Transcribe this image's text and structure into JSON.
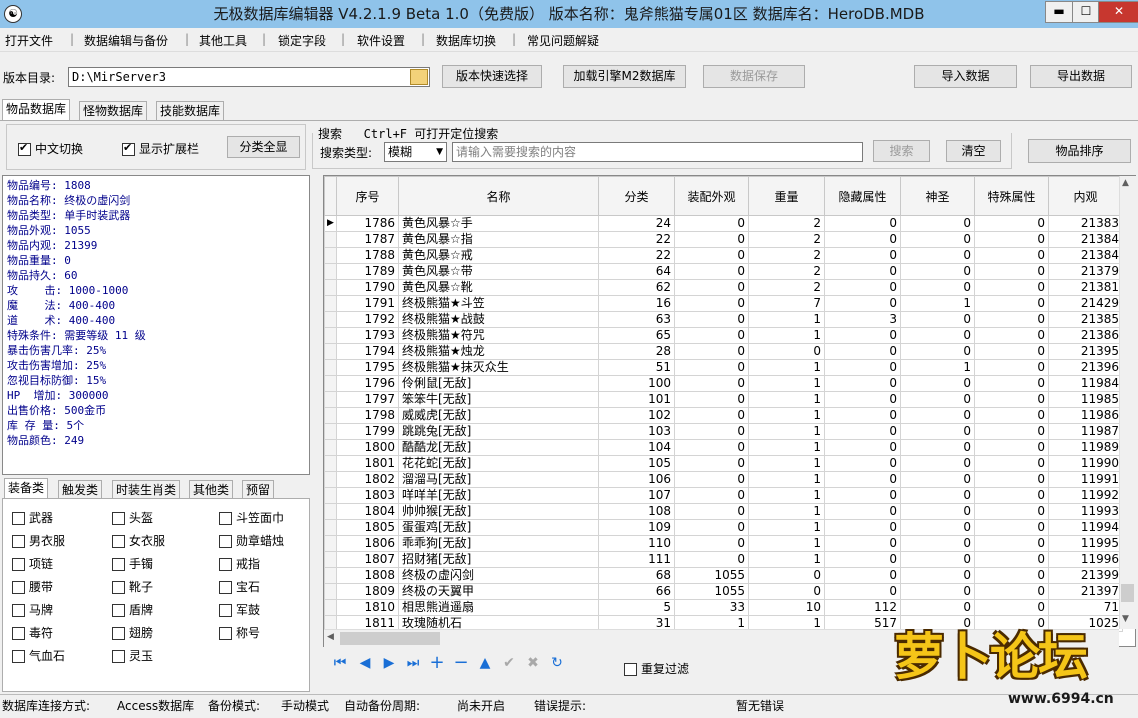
{
  "window": {
    "title": "无极数据库编辑器 V4.2.1.9    Beta 1.0（免费版）     版本名称：鬼斧熊猫专属01区     数据库名：HeroDB.MDB",
    "minimize": "▬",
    "maximize": "☐",
    "close": "✕"
  },
  "menu": [
    "打开文件",
    "数据编辑与备份",
    "其他工具",
    "锁定字段",
    "软件设置",
    "数据库切换",
    "常见问题解疑"
  ],
  "toolbar": {
    "dir_label": "版本目录:",
    "dir_value": "D:\\MirServer3",
    "quick_select": "版本快速选择",
    "load_m2": "加载引擎M2数据库",
    "save_data": "数据保存",
    "import_data": "导入数据",
    "export_data": "导出数据"
  },
  "tabs": [
    "物品数据库",
    "怪物数据库",
    "技能数据库"
  ],
  "options": {
    "chinese_switch": "中文切换",
    "show_ext": "显示扩展栏",
    "show_all": "分类全显",
    "search_hint": "搜索   Ctrl+F 可打开定位搜索",
    "search_type_label": "搜索类型:",
    "search_type_value": "模糊",
    "search_placeholder": "请输入需要搜索的内容",
    "search_button": "搜索",
    "clear_button": "清空",
    "sort_button": "物品排序"
  },
  "item_info": [
    "物品编号: 1808",
    "物品名称: 终极の虚闪剑",
    "物品类型: 单手时装武器",
    "物品外观: 1055",
    "物品内观: 21399",
    "物品重量: 0",
    "物品持久: 60",
    "攻    击: 1000-1000",
    "魔    法: 400-400",
    "道    术: 400-400",
    "特殊条件: 需要等级 11 级",
    "暴击伤害几率: 25%",
    "攻击伤害增加: 25%",
    "忽视目标防御: 15%",
    "HP  增加: 300000",
    "出售价格: 500金币",
    "库 存 量: 5个",
    "物品颜色: 249"
  ],
  "category_tabs": [
    "装备类",
    "触发类",
    "时装生肖类",
    "其他类",
    "预留"
  ],
  "categories": [
    [
      "武器",
      "头盔",
      "斗笠面巾"
    ],
    [
      "男衣服",
      "女衣服",
      "勋章蜡烛"
    ],
    [
      "项链",
      "手镯",
      "戒指"
    ],
    [
      "腰带",
      "靴子",
      "宝石"
    ],
    [
      "马牌",
      "盾牌",
      "军鼓"
    ],
    [
      "毒符",
      "翅膀",
      "称号"
    ],
    [
      "气血石",
      "灵玉"
    ]
  ],
  "grid": {
    "columns": [
      "序号",
      "名称",
      "分类",
      "装配外观",
      "重量",
      "隐藏属性",
      "神圣",
      "特殊属性",
      "内观"
    ],
    "rows": [
      [
        "1786",
        "黄色风暴☆手",
        "24",
        "0",
        "2",
        "0",
        "0",
        "0",
        "21383"
      ],
      [
        "1787",
        "黄色风暴☆指",
        "22",
        "0",
        "2",
        "0",
        "0",
        "0",
        "21384"
      ],
      [
        "1788",
        "黄色风暴☆戒",
        "22",
        "0",
        "2",
        "0",
        "0",
        "0",
        "21384"
      ],
      [
        "1789",
        "黄色风暴☆带",
        "64",
        "0",
        "2",
        "0",
        "0",
        "0",
        "21379"
      ],
      [
        "1790",
        "黄色风暴☆靴",
        "62",
        "0",
        "2",
        "0",
        "0",
        "0",
        "21381"
      ],
      [
        "1791",
        "终极熊猫★斗笠",
        "16",
        "0",
        "7",
        "0",
        "1",
        "0",
        "21429"
      ],
      [
        "1792",
        "终极熊猫★战鼓",
        "63",
        "0",
        "1",
        "3",
        "0",
        "0",
        "21385"
      ],
      [
        "1793",
        "终极熊猫★符咒",
        "65",
        "0",
        "1",
        "0",
        "0",
        "0",
        "21386"
      ],
      [
        "1794",
        "终极熊猫★烛龙",
        "28",
        "0",
        "0",
        "0",
        "0",
        "0",
        "21395"
      ],
      [
        "1795",
        "终极熊猫★抹灭众生",
        "51",
        "0",
        "1",
        "0",
        "1",
        "0",
        "21396"
      ],
      [
        "1796",
        "伶俐鼠[无敌]",
        "100",
        "0",
        "1",
        "0",
        "0",
        "0",
        "11984"
      ],
      [
        "1797",
        "笨笨牛[无敌]",
        "101",
        "0",
        "1",
        "0",
        "0",
        "0",
        "11985"
      ],
      [
        "1798",
        "威威虎[无敌]",
        "102",
        "0",
        "1",
        "0",
        "0",
        "0",
        "11986"
      ],
      [
        "1799",
        "跳跳兔[无敌]",
        "103",
        "0",
        "1",
        "0",
        "0",
        "0",
        "11987"
      ],
      [
        "1800",
        "酷酷龙[无敌]",
        "104",
        "0",
        "1",
        "0",
        "0",
        "0",
        "11989"
      ],
      [
        "1801",
        "花花蛇[无敌]",
        "105",
        "0",
        "1",
        "0",
        "0",
        "0",
        "11990"
      ],
      [
        "1802",
        "溜溜马[无敌]",
        "106",
        "0",
        "1",
        "0",
        "0",
        "0",
        "11991"
      ],
      [
        "1803",
        "咩咩羊[无敌]",
        "107",
        "0",
        "1",
        "0",
        "0",
        "0",
        "11992"
      ],
      [
        "1804",
        "帅帅猴[无敌]",
        "108",
        "0",
        "1",
        "0",
        "0",
        "0",
        "11993"
      ],
      [
        "1805",
        "蛋蛋鸡[无敌]",
        "109",
        "0",
        "1",
        "0",
        "0",
        "0",
        "11994"
      ],
      [
        "1806",
        "乖乖狗[无敌]",
        "110",
        "0",
        "1",
        "0",
        "0",
        "0",
        "11995"
      ],
      [
        "1807",
        "招财猪[无敌]",
        "111",
        "0",
        "1",
        "0",
        "0",
        "0",
        "11996"
      ],
      [
        "1808",
        "终极の虚闪剑",
        "68",
        "1055",
        "0",
        "0",
        "0",
        "0",
        "21399"
      ],
      [
        "1809",
        "终极の天翼甲",
        "66",
        "1055",
        "0",
        "0",
        "0",
        "0",
        "21397"
      ],
      [
        "1810",
        "相思熊逍遥扇",
        "5",
        "33",
        "10",
        "112",
        "0",
        "0",
        "71"
      ],
      [
        "1811",
        "玫瑰随机石",
        "31",
        "1",
        "1",
        "517",
        "0",
        "0",
        "1025"
      ]
    ]
  },
  "navigator": {
    "first": "⏮",
    "prior": "◀",
    "next": "▶",
    "last": "⏭",
    "insert": "+",
    "delete": "−",
    "edit": "▲",
    "post": "✔",
    "cancel": "✖",
    "refresh": "↻"
  },
  "dup_filter": "重复过滤",
  "status": {
    "conn_label": "数据库连接方式:",
    "conn_value": "Access数据库",
    "backup_mode_label": "备份模式:",
    "backup_mode_value": "手动模式",
    "auto_backup_label": "自动备份周期:",
    "auto_backup_value": "尚未开启",
    "error_label": "错误提示:",
    "error_value": "暂无错误"
  },
  "logo": {
    "text": "萝卜论坛",
    "url_text": "www.6994.cn"
  }
}
